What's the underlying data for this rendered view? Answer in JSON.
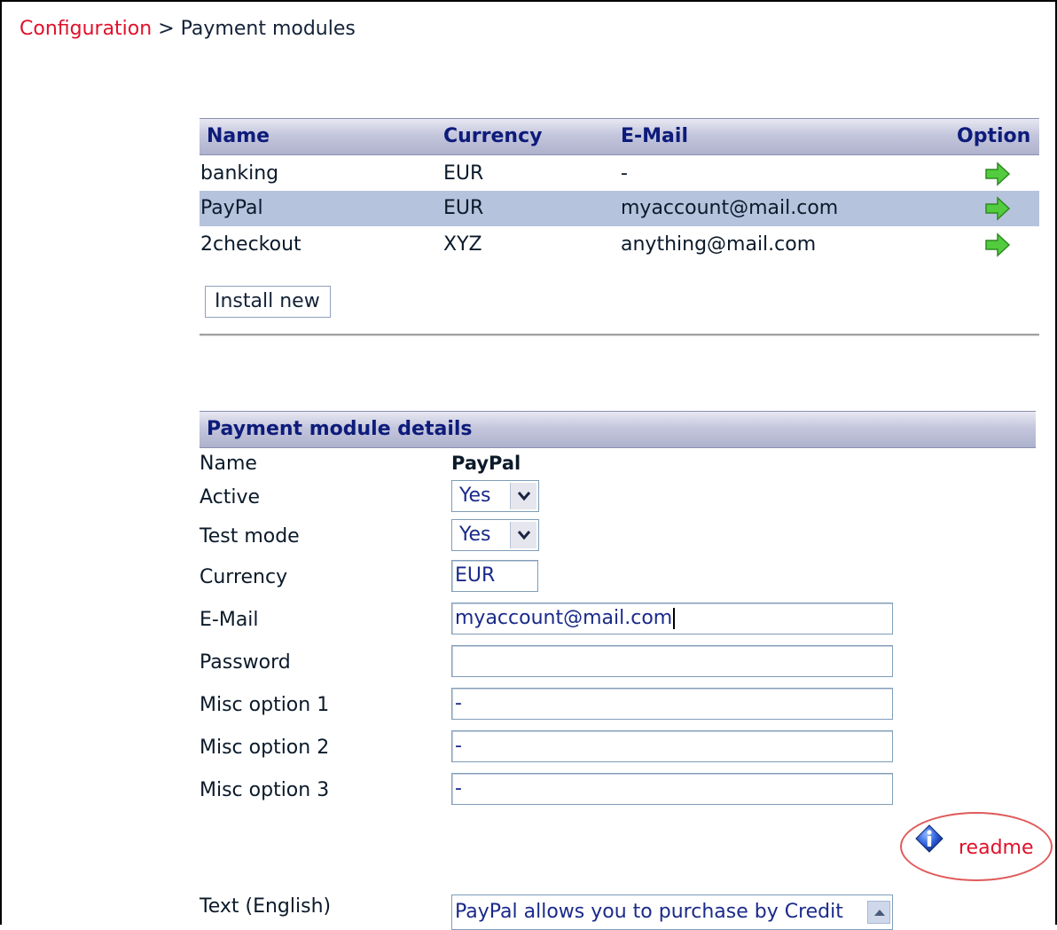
{
  "breadcrumb": {
    "link": "Configuration",
    "separator": ">",
    "current": "Payment modules"
  },
  "modules_table": {
    "headers": {
      "name": "Name",
      "currency": "Currency",
      "email": "E-Mail",
      "option": "Option"
    },
    "rows": [
      {
        "name": "banking",
        "currency": "EUR",
        "email": "-",
        "selected": false,
        "option_icon": "green-arrow-right-icon"
      },
      {
        "name": "PayPal",
        "currency": "EUR",
        "email": "myaccount@mail.com",
        "selected": true,
        "option_icon": "green-arrow-right-icon"
      },
      {
        "name": "2checkout",
        "currency": "XYZ",
        "email": "anything@mail.com",
        "selected": false,
        "option_icon": "green-arrow-right-icon"
      }
    ],
    "install_button": "Install new"
  },
  "details": {
    "header": "Payment module details",
    "name_label": "Name",
    "name_value": "PayPal",
    "active_label": "Active",
    "active_value": "Yes",
    "test_mode_label": "Test mode",
    "test_mode_value": "Yes",
    "currency_label": "Currency",
    "currency_value": "EUR",
    "email_label": "E-Mail",
    "email_value": "myaccount@mail.com",
    "password_label": "Password",
    "password_value": "",
    "misc1_label": "Misc option 1",
    "misc1_value": "-",
    "misc2_label": "Misc option 2",
    "misc2_value": "-",
    "misc3_label": "Misc option 3",
    "misc3_value": "-",
    "readme_label": "readme",
    "text_label": "Text (English)",
    "text_value": "PayPal allows you to purchase by Credit"
  },
  "colors": {
    "link": "#e0102a",
    "header_text": "#0d1b7a",
    "selected_row": "#b6c3dc",
    "arrow": "#4cc43a",
    "readme_circle": "#e05a5a"
  }
}
